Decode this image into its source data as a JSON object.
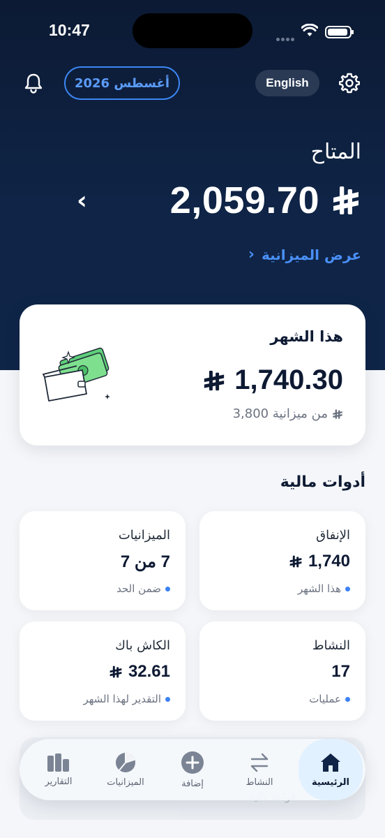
{
  "status_bar": {
    "time": "10:47"
  },
  "header": {
    "month": "أغسطس 2026",
    "language": "English"
  },
  "available": {
    "label": "المتاح",
    "amount": "2,059.70",
    "currency_symbol": "⃁",
    "view_budget": "عرض الميزانية"
  },
  "this_month": {
    "title": "هذا الشهر",
    "amount": "1,740.30",
    "subtitle": "من ميزانية 3,800"
  },
  "tools": {
    "title": "أدوات مالية",
    "tiles": [
      {
        "title": "الإنفاق",
        "value": "1,740",
        "sub": "هذا الشهر"
      },
      {
        "title": "الميزانيات",
        "value": "7 من 7",
        "sub": "ضمن الحد"
      },
      {
        "title": "النشاط",
        "value": "17",
        "sub": "عمليات"
      },
      {
        "title": "الكاش باك",
        "value": "32.61",
        "sub": "التقدير لهذا الشهر"
      }
    ]
  },
  "ghost": {
    "text": "قواعد ذكية"
  },
  "tabbar": {
    "items": [
      {
        "label": "الرئيسية",
        "icon": "home-icon"
      },
      {
        "label": "النشاط",
        "icon": "transfer-arrows-icon"
      },
      {
        "label": "إضافة",
        "icon": "add-circle-icon"
      },
      {
        "label": "الميزانيات",
        "icon": "pie-chart-icon"
      },
      {
        "label": "التقارير",
        "icon": "bar-chart-icon"
      }
    ]
  },
  "colors": {
    "navy": "#0f2446",
    "accent": "#3b82f6",
    "active_tab": "#e2f1ff"
  }
}
